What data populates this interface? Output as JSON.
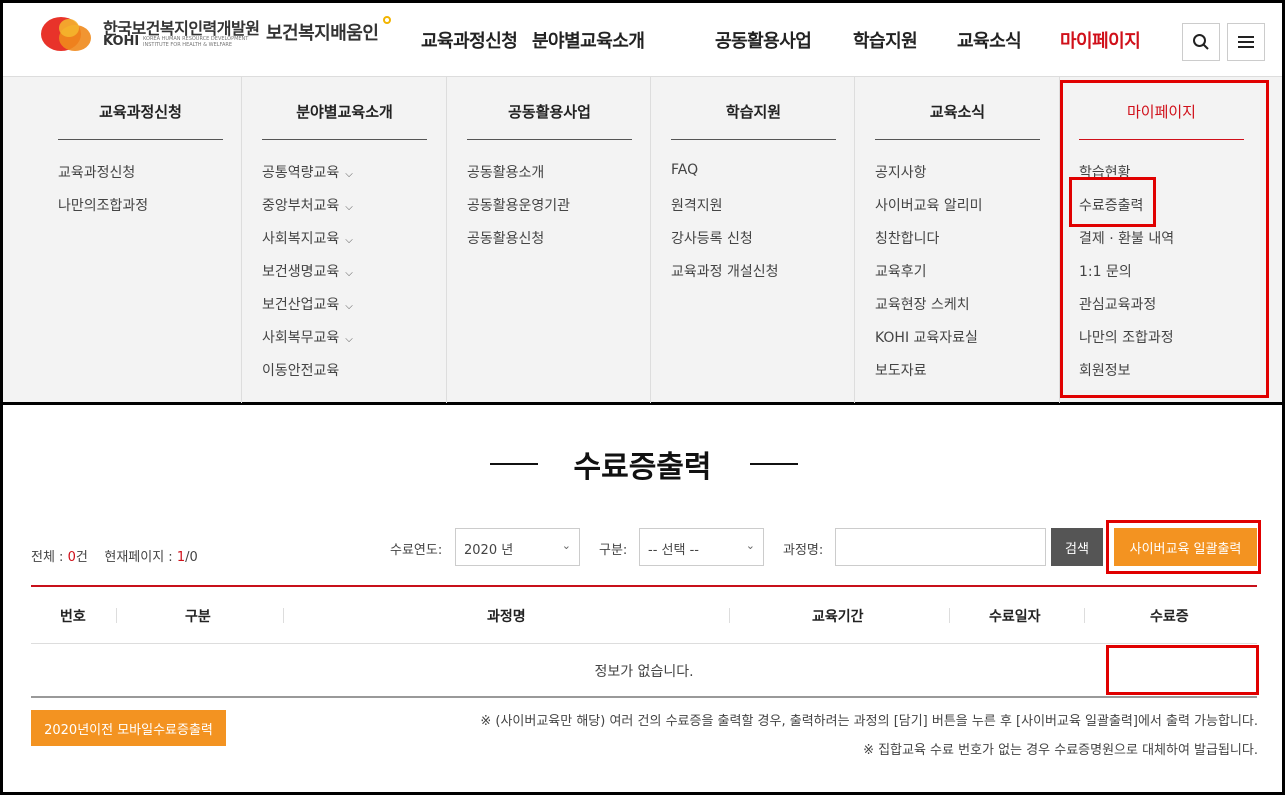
{
  "header": {
    "org_name_kr": "한국보건복지인력개발원",
    "org_name_en": "KOHI",
    "org_name_sub": "KOREA HUMAN RESOURCE DEVELOPMENT INSTITUTE FOR HEALTH & WELFARE",
    "brand": "보건복지배움인",
    "nav": [
      "교육과정신청",
      "분야별교육소개",
      "공동활용사업",
      "학습지원",
      "교육소식",
      "마이페이지"
    ],
    "search_icon": "search-icon",
    "menu_icon": "hamburger-icon"
  },
  "mega_menu": {
    "columns": [
      {
        "title": "교육과정신청",
        "items": [
          "교육과정신청",
          "나만의조합과정"
        ]
      },
      {
        "title": "분야별교육소개",
        "items": [
          "공통역량교육",
          "중앙부처교육",
          "사회복지교육",
          "보건생명교육",
          "보건산업교육",
          "사회복무교육",
          "이동안전교육"
        ]
      },
      {
        "title": "공동활용사업",
        "items": [
          "공동활용소개",
          "공동활용운영기관",
          "공동활용신청"
        ]
      },
      {
        "title": "학습지원",
        "items": [
          "FAQ",
          "원격지원",
          "강사등록 신청",
          "교육과정 개설신청"
        ]
      },
      {
        "title": "교육소식",
        "items": [
          "공지사항",
          "사이버교육 알리미",
          "칭찬합니다",
          "교육후기",
          "교육현장 스케치",
          "KOHI 교육자료실",
          "보도자료"
        ]
      },
      {
        "title": "마이페이지",
        "items": [
          "학습현황",
          "수료증출력",
          "결제 · 환불 내역",
          "1:1 문의",
          "관심교육과정",
          "나만의 조합과정",
          "회원정보"
        ]
      }
    ]
  },
  "page": {
    "title": "수료증출력",
    "summary_total_label": "전체 : ",
    "summary_total": "0",
    "summary_total_unit": "건",
    "summary_page_label": "현재페이지 : ",
    "summary_page_current": "1",
    "summary_page_total": "/0",
    "filter_year_label": "수료연도:",
    "filter_year_value": "2020 년",
    "filter_type_label": "구분:",
    "filter_type_value": "-- 선택 --",
    "filter_course_label": "과정명:",
    "search_button": "검색",
    "bulk_print_button": "사이버교육 일괄출력",
    "table_headers": [
      "번호",
      "구분",
      "과정명",
      "교육기간",
      "수료일자",
      "수료증"
    ],
    "empty_message": "정보가 없습니다.",
    "mobile_print_button": "2020년이전 모바일수료증출력",
    "note1": "※ (사이버교육만 해당) 여러 건의 수료증을 출력할 경우, 출력하려는 과정의 [담기] 버튼을 누른 후 [사이버교육 일괄출력]에서 출력 가능합니다.",
    "note2": "※ 집합교육 수료 번호가 없는 경우 수료증명원으로 대체하여 발급됩니다."
  },
  "colors": {
    "accent_red": "#d0101a",
    "orange": "#f39321",
    "annotation_red": "#e00000"
  }
}
